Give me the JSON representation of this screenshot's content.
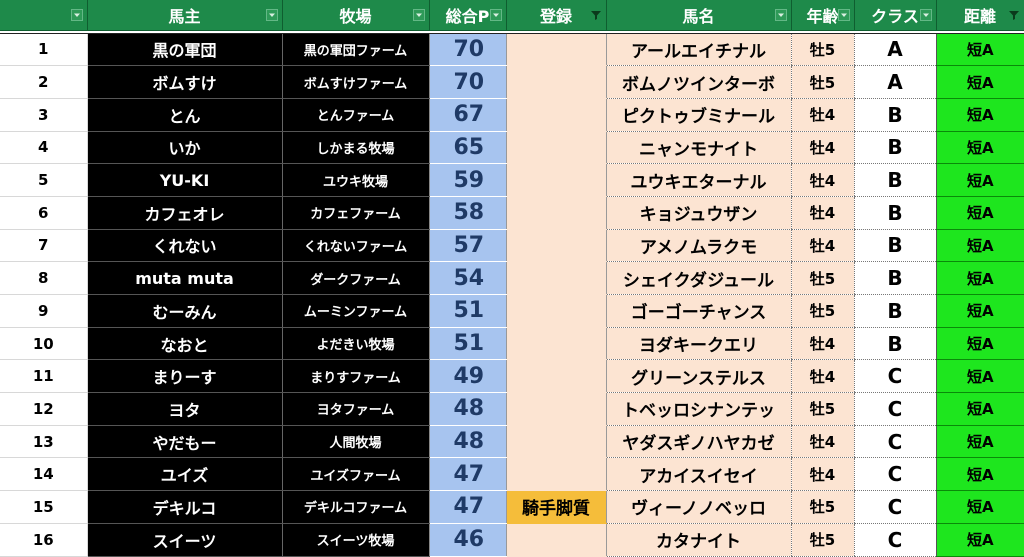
{
  "colors": {
    "header_bg": "#1e8a4a",
    "owner_bg": "#000000",
    "points_bg": "#a7c4ef",
    "registration_bg": "#fce4d2",
    "registration_highlight": "#f5bd3a",
    "distance_bg": "#1ee61e"
  },
  "headers": [
    {
      "key": "rank",
      "label": ""
    },
    {
      "key": "owner",
      "label": "馬主"
    },
    {
      "key": "farm",
      "label": "牧場"
    },
    {
      "key": "points",
      "label": "総合P"
    },
    {
      "key": "registration",
      "label": "登録"
    },
    {
      "key": "horse",
      "label": "馬名"
    },
    {
      "key": "age",
      "label": "年齢"
    },
    {
      "key": "class",
      "label": "クラス"
    },
    {
      "key": "distance",
      "label": "距離"
    }
  ],
  "filter_icons": {
    "rank": "filter-dropdown-icon",
    "owner": "filter-dropdown-icon",
    "farm": "filter-dropdown-icon",
    "points": "filter-dropdown-icon",
    "registration": "filter-active-icon",
    "horse": "filter-dropdown-icon",
    "age": "filter-dropdown-icon",
    "class": "filter-dropdown-icon",
    "distance": "filter-active-icon"
  },
  "rows": [
    {
      "rank": "1",
      "owner": "黒の軍団",
      "farm": "黒の軍団ファーム",
      "points": "70",
      "registration": "",
      "horse": "アールエイチナル",
      "age": "牡5",
      "class": "A",
      "distance": "短A"
    },
    {
      "rank": "2",
      "owner": "ボムすけ",
      "farm": "ボムすけファーム",
      "points": "70",
      "registration": "",
      "horse": "ボムノツインターボ",
      "age": "牡5",
      "class": "A",
      "distance": "短A"
    },
    {
      "rank": "3",
      "owner": "とん",
      "farm": "とんファーム",
      "points": "67",
      "registration": "",
      "horse": "ピクトゥブミナール",
      "age": "牡4",
      "class": "B",
      "distance": "短A"
    },
    {
      "rank": "4",
      "owner": "いか",
      "farm": "しかまる牧場",
      "points": "65",
      "registration": "",
      "horse": "ニャンモナイト",
      "age": "牡4",
      "class": "B",
      "distance": "短A"
    },
    {
      "rank": "5",
      "owner": "YU-KI",
      "farm": "ユウキ牧場",
      "points": "59",
      "registration": "",
      "horse": "ユウキエターナル",
      "age": "牡4",
      "class": "B",
      "distance": "短A"
    },
    {
      "rank": "6",
      "owner": "カフェオレ",
      "farm": "カフェファーム",
      "points": "58",
      "registration": "",
      "horse": "キョジュウザン",
      "age": "牡4",
      "class": "B",
      "distance": "短A"
    },
    {
      "rank": "7",
      "owner": "くれない",
      "farm": "くれないファーム",
      "points": "57",
      "registration": "",
      "horse": "アメノムラクモ",
      "age": "牡4",
      "class": "B",
      "distance": "短A"
    },
    {
      "rank": "8",
      "owner": "muta muta",
      "farm": "ダークファーム",
      "points": "54",
      "registration": "",
      "horse": "シェイクダジュール",
      "age": "牡5",
      "class": "B",
      "distance": "短A"
    },
    {
      "rank": "9",
      "owner": "むーみん",
      "farm": "ムーミンファーム",
      "points": "51",
      "registration": "",
      "horse": "ゴーゴーチャンス",
      "age": "牡5",
      "class": "B",
      "distance": "短A"
    },
    {
      "rank": "10",
      "owner": "なおと",
      "farm": "よだきい牧場",
      "points": "51",
      "registration": "",
      "horse": "ヨダキークエリ",
      "age": "牡4",
      "class": "B",
      "distance": "短A"
    },
    {
      "rank": "11",
      "owner": "まりーす",
      "farm": "まりすファーム",
      "points": "49",
      "registration": "",
      "horse": "グリーンステルス",
      "age": "牡4",
      "class": "C",
      "distance": "短A"
    },
    {
      "rank": "12",
      "owner": "ヨタ",
      "farm": "ヨタファーム",
      "points": "48",
      "registration": "",
      "horse": "トベッロシナンテッ",
      "age": "牡5",
      "class": "C",
      "distance": "短A"
    },
    {
      "rank": "13",
      "owner": "やだもー",
      "farm": "人間牧場",
      "points": "48",
      "registration": "",
      "horse": "ヤダスギノハヤカゼ",
      "age": "牡4",
      "class": "C",
      "distance": "短A"
    },
    {
      "rank": "14",
      "owner": "ユイズ",
      "farm": "ユイズファーム",
      "points": "47",
      "registration": "",
      "horse": "アカイスイセイ",
      "age": "牡4",
      "class": "C",
      "distance": "短A"
    },
    {
      "rank": "15",
      "owner": "デキルコ",
      "farm": "デキルコファーム",
      "points": "47",
      "registration": "騎手脚質",
      "horse": "ヴィーノノベッロ",
      "age": "牡5",
      "class": "C",
      "distance": "短A"
    },
    {
      "rank": "16",
      "owner": "スイーツ",
      "farm": "スイーツ牧場",
      "points": "46",
      "registration": "",
      "horse": "カタナイト",
      "age": "牡5",
      "class": "C",
      "distance": "短A"
    }
  ]
}
